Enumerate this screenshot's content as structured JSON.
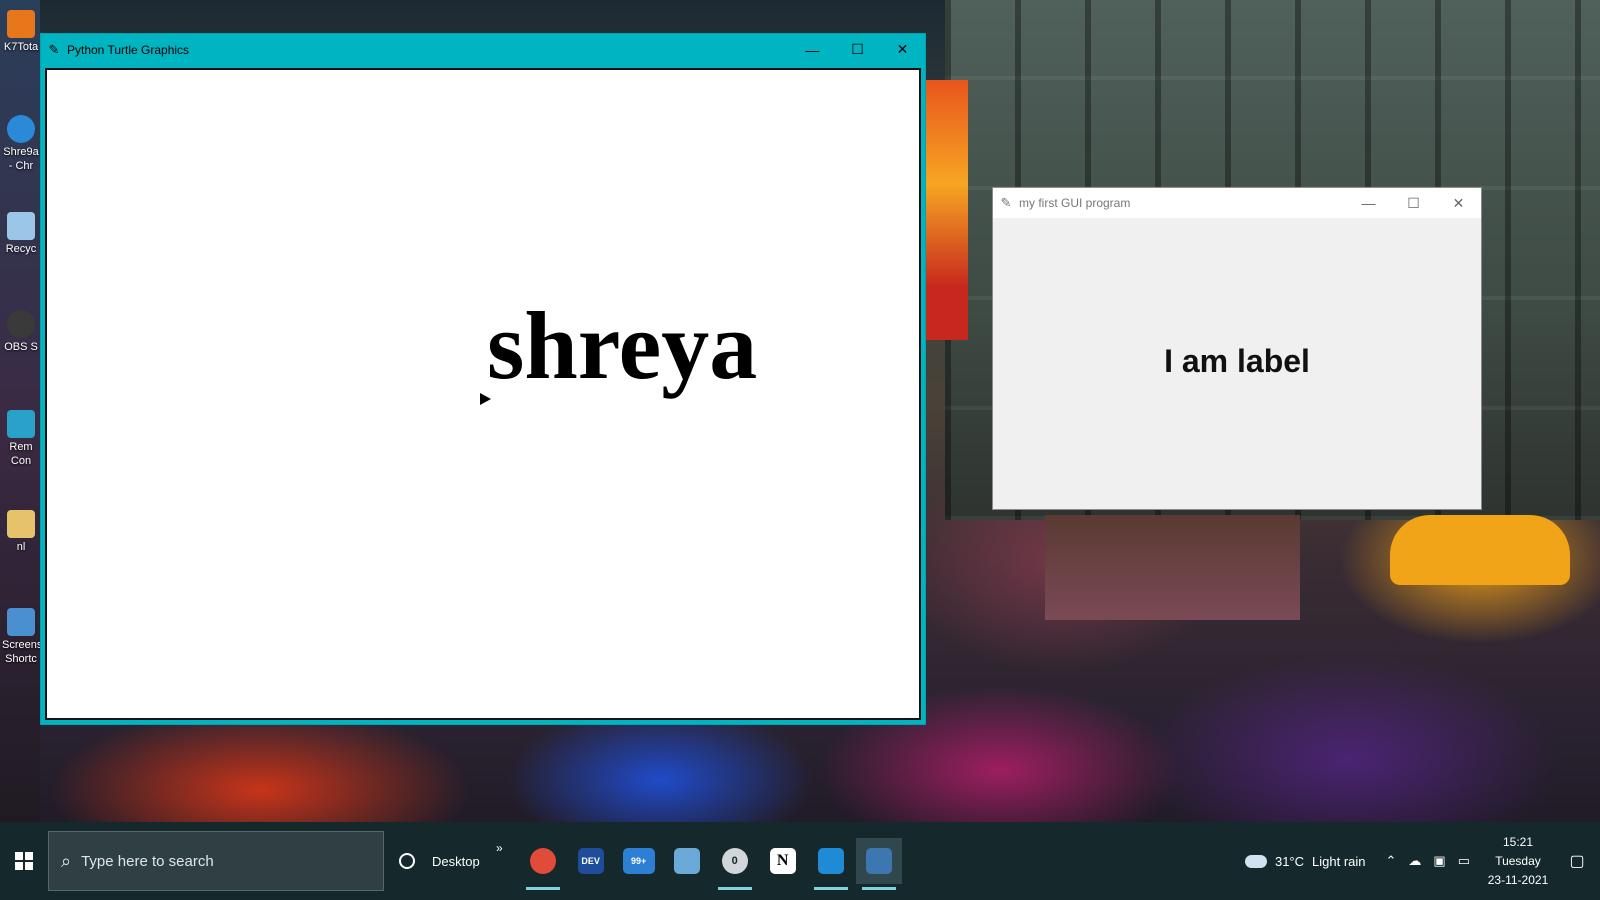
{
  "desktop": {
    "icons": [
      {
        "label": "K7Tota",
        "color": "#e8761b"
      },
      {
        "label": "Shre9a - Chr",
        "color": "#2a8ad8"
      },
      {
        "label": "Recyc",
        "color": "#9cc6e8"
      },
      {
        "label": "OBS S",
        "color": "#3a3a3a"
      },
      {
        "label": "Rem Con",
        "color": "#2aa1c8"
      },
      {
        "label": "nl",
        "color": "#e6c26a"
      },
      {
        "label": "Screens Shortc",
        "color": "#4a8fd0"
      }
    ]
  },
  "turtle_window": {
    "title": "Python Turtle Graphics",
    "text": "shreya",
    "controls": {
      "minimize": "—",
      "maximize": "☐",
      "close": "✕"
    }
  },
  "gui_window": {
    "title": "my first GUI program",
    "label": "I am label",
    "controls": {
      "minimize": "—",
      "maximize": "☐",
      "close": "✕"
    }
  },
  "taskbar": {
    "search_placeholder": "Type here to search",
    "desktop_label": "Desktop",
    "chevron": "»",
    "apps": [
      {
        "name": "chrome",
        "badge": "",
        "color": "#e04b3a"
      },
      {
        "name": "dev",
        "badge": "DEV",
        "color": "#1e4d9a"
      },
      {
        "name": "mail",
        "badge": "99+",
        "color": "#2d7fd3"
      },
      {
        "name": "remote",
        "badge": "",
        "color": "#6aa9d8"
      },
      {
        "name": "clock-app",
        "badge": "0",
        "color": "#d0d6da"
      },
      {
        "name": "notion",
        "badge": "N",
        "color": "#ffffff"
      },
      {
        "name": "vscode",
        "badge": "",
        "color": "#1f8ad6"
      },
      {
        "name": "python",
        "badge": "",
        "color": "#3d77b0"
      }
    ],
    "weather": {
      "temp": "31°C",
      "condition": "Light rain"
    },
    "clock": {
      "time": "15:21",
      "day": "Tuesday",
      "date": "23-11-2021"
    }
  }
}
